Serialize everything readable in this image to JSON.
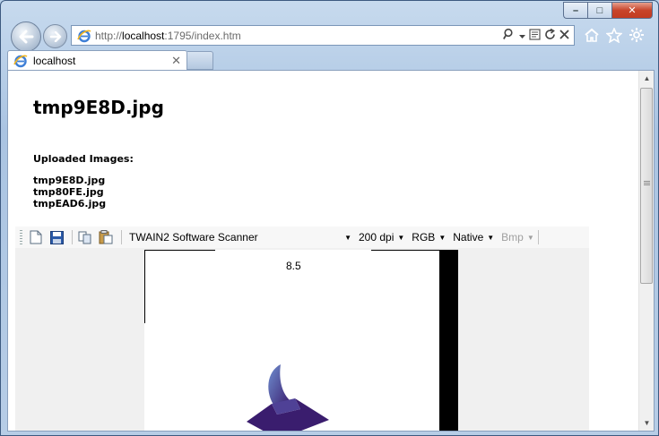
{
  "browser": {
    "url_prefix": "http://",
    "url_host": "localhost",
    "url_rest": ":1795/index.htm",
    "tab_title": "localhost",
    "caption": {
      "minimize": "–",
      "maximize": "□",
      "close": "✕"
    }
  },
  "page": {
    "heading": "tmp9E8D.jpg",
    "uploaded_label": "Uploaded Images:",
    "files": [
      "tmp9E8D.jpg",
      "tmp80FE.jpg",
      "tmpEAD6.jpg"
    ]
  },
  "scanner": {
    "source": "TWAIN2 Software Scanner",
    "resolution": "200 dpi",
    "color_mode": "RGB",
    "size": "Native",
    "format": "Bmp",
    "preview_label": "8.5"
  },
  "colors": {
    "accent": "#3f7fd6",
    "art_dark": "#3a1d6e",
    "art_light": "#6f8fd0"
  }
}
